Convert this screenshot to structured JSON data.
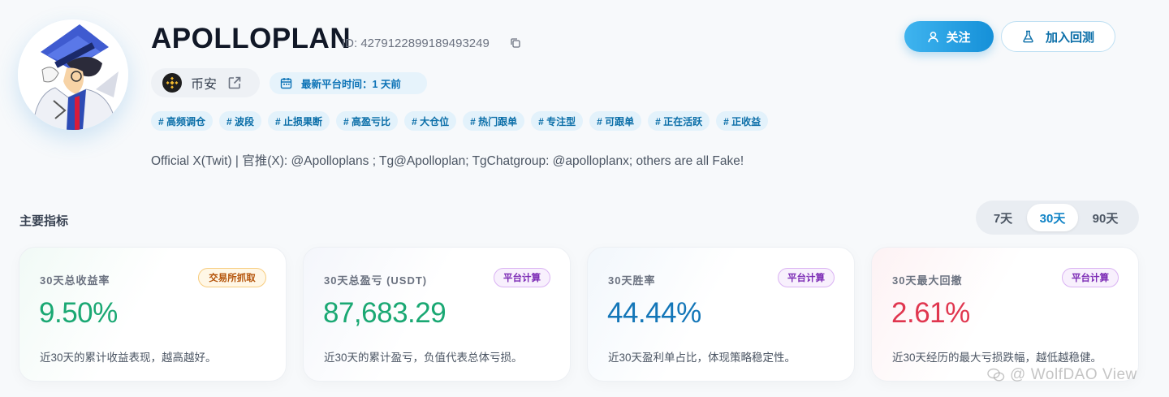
{
  "profile": {
    "name": "APOLLOPLAN",
    "id_text": "ID: 4279122899189493249",
    "exchange": "币安",
    "last_time_label": "最新平台时间：1 天前",
    "tags": [
      "# 高频调仓",
      "# 波段",
      "# 止损果断",
      "# 高盈亏比",
      "# 大仓位",
      "# 热门跟单",
      "# 专注型",
      "# 可跟单",
      "# 正在活跃",
      "# 正收益"
    ],
    "bio": "Official X(Twit) | 官推(X): @Apolloplans ; Tg@Apolloplan; TgChatgroup: @apolloplanx; others are all Fake!"
  },
  "actions": {
    "follow_label": "关注",
    "backtest_label": "加入回测"
  },
  "metrics": {
    "section_title": "主要指标",
    "periods": [
      "7天",
      "30天",
      "90天"
    ],
    "selected_period": "30天",
    "cards": [
      {
        "label": "30天总收益率",
        "badge": "交易所抓取",
        "value": "9.50%",
        "desc": "近30天的累计收益表现，越高越好。",
        "value_color": "#1aa873"
      },
      {
        "label": "30天总盈亏 (USDT)",
        "badge": "平台计算",
        "value": "87,683.29",
        "desc": "近30天的累计盈亏，负值代表总体亏损。",
        "value_color": "#1aa873"
      },
      {
        "label": "30天胜率",
        "badge": "平台计算",
        "value": "44.44%",
        "desc": "近30天盈利单占比，体现策略稳定性。",
        "value_color": "#1376b8"
      },
      {
        "label": "30天最大回撤",
        "badge": "平台计算",
        "value": "2.61%",
        "desc": "近30天经历的最大亏损跌幅，越低越稳健。",
        "value_color": "#e0364f"
      }
    ]
  },
  "watermark": "WolfDAO View",
  "colors": {
    "accent": "#1590d8",
    "tag_bg": "#e3f2fb",
    "tag_text": "#0a6ea8"
  }
}
